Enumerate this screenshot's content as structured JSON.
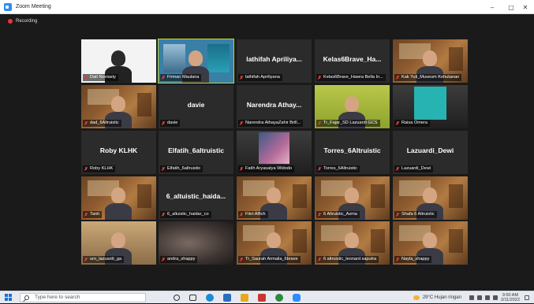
{
  "window": {
    "title": "Zoom Meeting",
    "recording_label": "Recording",
    "controls": {
      "minimize": "–",
      "maximize": "▢",
      "close": "✕"
    }
  },
  "participants": [
    {
      "display_name": "",
      "label": "Dait Noviasty",
      "video": "white"
    },
    {
      "display_name": "",
      "label": "Firman Maulana",
      "video": "slides",
      "active": true
    },
    {
      "display_name": "lathifah Apriliya...",
      "label": "lathifah Apriliyana",
      "video": "none"
    },
    {
      "display_name": "Kelas6Brave_Ha...",
      "label": "Kelas6Brave_Hawra Bella In...",
      "video": "none"
    },
    {
      "display_name": "",
      "label": "Kak Yuli_Museum Kehutanan",
      "video": "museum"
    },
    {
      "display_name": "",
      "label": "dad_6Altruistic",
      "video": "museum"
    },
    {
      "display_name": "davie",
      "label": "davie",
      "video": "none"
    },
    {
      "display_name": "Narendra Athay...",
      "label": "Narendra AthayaZahir Brill...",
      "video": "none"
    },
    {
      "display_name": "",
      "label": "Tr_Fajar_SD Lazuardi GCS",
      "video": "lime"
    },
    {
      "display_name": "",
      "label": "Raisa Omera",
      "video": "teal"
    },
    {
      "display_name": "Roby KLHK",
      "label": "Roby KLHK",
      "video": "none"
    },
    {
      "display_name": "Elfatih_6altruistic",
      "label": "Elfatih_6altruistic",
      "video": "none"
    },
    {
      "display_name": "",
      "label": "Fatih Aryasatya Widodo",
      "video": "avatar"
    },
    {
      "display_name": "Torres_6Altruistic",
      "label": "Torres_6Altruistic",
      "video": "none"
    },
    {
      "display_name": "Lazuardi_Dewi",
      "label": "Lazuardi_Dewi",
      "video": "none"
    },
    {
      "display_name": "",
      "label": "Tanti",
      "video": "museum"
    },
    {
      "display_name": "6_altuistic_haida...",
      "label": "6_altuistic_haidar_co",
      "video": "none"
    },
    {
      "display_name": "",
      "label": "Fikri Alfich",
      "video": "museum"
    },
    {
      "display_name": "",
      "label": "6 Altruistic_Azma",
      "video": "museum"
    },
    {
      "display_name": "",
      "label": "Shafa 6 Altruistic",
      "video": "museum"
    },
    {
      "display_name": "",
      "label": "uro_lazuardi_ga",
      "video": "room"
    },
    {
      "display_name": "",
      "label": "andra_shappy",
      "video": "blur"
    },
    {
      "display_name": "",
      "label": "Tr_Saurah Armaila_6brave",
      "video": "museum"
    },
    {
      "display_name": "",
      "label": "6 altruistic_leonard saputra",
      "video": "museum"
    },
    {
      "display_name": "",
      "label": "Nayla_shappy",
      "video": "museum"
    }
  ],
  "taskbar": {
    "search_placeholder": "Type here to search",
    "weather": "29°C  Hujan ringan",
    "time": "9:50 AM",
    "date": "2/11/2022"
  }
}
